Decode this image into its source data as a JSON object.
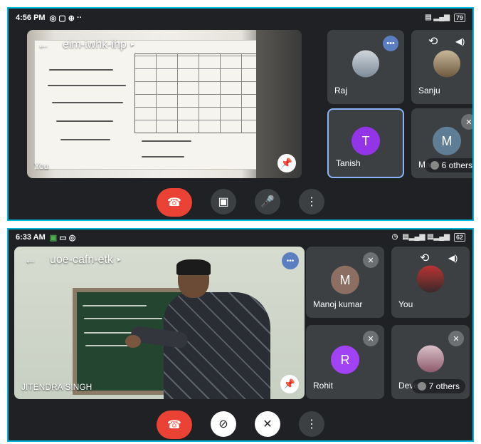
{
  "colors": {
    "border_accent": "#00b4d8",
    "end_call": "#ea4335",
    "tile_bg": "#3c4043",
    "app_bg": "#202124",
    "select": "#8ab4f8",
    "avatar_purple": "#9334e6",
    "avatar_brown": "#8d6e63",
    "avatar_slate": "#5f7d95",
    "avatar_violet": "#a142f4"
  },
  "shot1": {
    "status": {
      "time": "4:56 PM",
      "icons": [
        "whatsapp-icon",
        "sim-icon",
        "settings-icon",
        "more-icon"
      ],
      "battery": "79"
    },
    "meeting_code": "eim-iwhk-ihp",
    "main_tile_name": "You",
    "participants": [
      {
        "name": "Raj",
        "type": "photo"
      },
      {
        "name": "Sanju",
        "type": "photo"
      },
      {
        "name": "Tanish",
        "initial": "T",
        "selected": true
      },
      {
        "name": "Ma",
        "initial": "M",
        "others": "6 others"
      }
    ]
  },
  "shot2": {
    "status": {
      "time": "6:33 AM",
      "icons": [
        "app-icon",
        "chat-icon",
        "whatsapp-icon"
      ],
      "battery": "62"
    },
    "meeting_code": "uoe-cafn-etk",
    "main_tile_name": "JITENDRA SINGH",
    "participants": [
      {
        "name": "Manoj kumar",
        "initial": "M"
      },
      {
        "name": "You",
        "type": "photo"
      },
      {
        "name": "Rohit",
        "initial": "R"
      },
      {
        "name": "Deve",
        "type": "photo",
        "others": "7 others"
      }
    ]
  },
  "glyphs": {
    "back": "←",
    "caret": "▸",
    "pin": "⌖",
    "dots": "•••",
    "end": "☎",
    "camera": "▣",
    "mic": "🎙",
    "menu": "⋮",
    "mic_off": "✕",
    "flip": "⟲",
    "speaker": "◀)",
    "cam_off": "⊘"
  }
}
